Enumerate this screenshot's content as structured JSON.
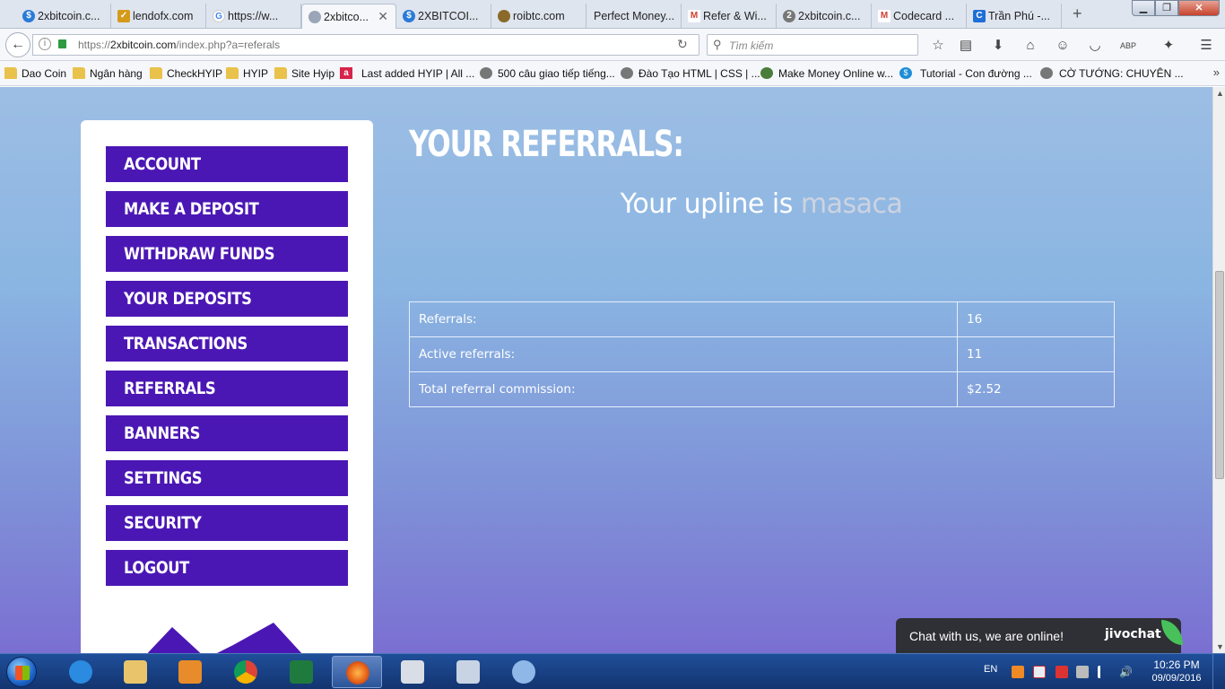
{
  "browser": {
    "tabs": [
      {
        "label": "2xbitcoin.c...",
        "icon": "2x-icon",
        "color": "#2a7bd8"
      },
      {
        "label": "lendofx.com",
        "icon": "lendofx-icon",
        "color": "#d49a1a"
      },
      {
        "label": "https://w...",
        "icon": "google-icon",
        "color": "#4285f4"
      },
      {
        "label": "2xbitco...",
        "icon": "2x-icon",
        "color": "#9aa6b8",
        "active": true
      },
      {
        "label": "2XBITCOI...",
        "icon": "2x-icon",
        "color": "#2a7bd8"
      },
      {
        "label": "roibtc.com",
        "icon": "roibtc-icon",
        "color": "#8a6a2a"
      },
      {
        "label": "Perfect Money...",
        "icon": "",
        "color": ""
      },
      {
        "label": "Refer & Wi...",
        "icon": "gmail-icon",
        "color": "#d23f31"
      },
      {
        "label": "2xbitcoin.c...",
        "icon": "2x-icon",
        "color": "#777"
      },
      {
        "label": "Codecard ...",
        "icon": "gmail-icon",
        "color": "#d23f31"
      },
      {
        "label": "Trần Phú -...",
        "icon": "c-icon",
        "color": "#1e6fd6"
      }
    ],
    "url_prefix": "https://",
    "url_host": "2xbitcoin.com",
    "url_path": "/index.php?a=referals",
    "search_placeholder": "Tìm kiếm",
    "bookmarks": [
      {
        "label": "Dao Coin",
        "icon": "folder"
      },
      {
        "label": "Ngân hàng",
        "icon": "folder"
      },
      {
        "label": "CheckHYIP",
        "icon": "folder"
      },
      {
        "label": "HYIP",
        "icon": "folder"
      },
      {
        "label": "Site Hyip",
        "icon": "folder"
      },
      {
        "label": "Last added HYIP | All ...",
        "icon": "a"
      },
      {
        "label": "500 câu giao tiếp tiếng...",
        "icon": "globe"
      },
      {
        "label": "Đào Tạo HTML | CSS | ...",
        "icon": "globe"
      },
      {
        "label": "Make Money Online w...",
        "icon": "globe"
      },
      {
        "label": "Tutorial - Con đường ...",
        "icon": "s"
      },
      {
        "label": "CỜ TƯỚNG: CHUYÊN ...",
        "icon": "globe"
      }
    ]
  },
  "sidebar": {
    "items": [
      {
        "label": "ACCOUNT"
      },
      {
        "label": "MAKE A DEPOSIT"
      },
      {
        "label": "WITHDRAW FUNDS"
      },
      {
        "label": "YOUR DEPOSITS"
      },
      {
        "label": "TRANSACTIONS"
      },
      {
        "label": "REFERRALS"
      },
      {
        "label": "BANNERS"
      },
      {
        "label": "SETTINGS"
      },
      {
        "label": "SECURITY"
      },
      {
        "label": "LOGOUT"
      }
    ]
  },
  "main": {
    "title": "YOUR REFERRALS:",
    "upline_prefix": "Your upline is ",
    "upline_name": "masaca",
    "table": [
      {
        "label": "Referrals:",
        "value": "16"
      },
      {
        "label": "Active referrals:",
        "value": "11"
      },
      {
        "label": "Total referral commission:",
        "value": "$2.52"
      }
    ]
  },
  "chat": {
    "message": "Chat with us, we are online!",
    "brand": "jivochat"
  },
  "taskbar": {
    "lang": "EN",
    "time": "10:26 PM",
    "date": "09/09/2016"
  },
  "colors": {
    "menu_bg": "#4b17b4",
    "page_bg_top": "#9dbee4",
    "page_bg_bottom": "#7b6fd2"
  }
}
